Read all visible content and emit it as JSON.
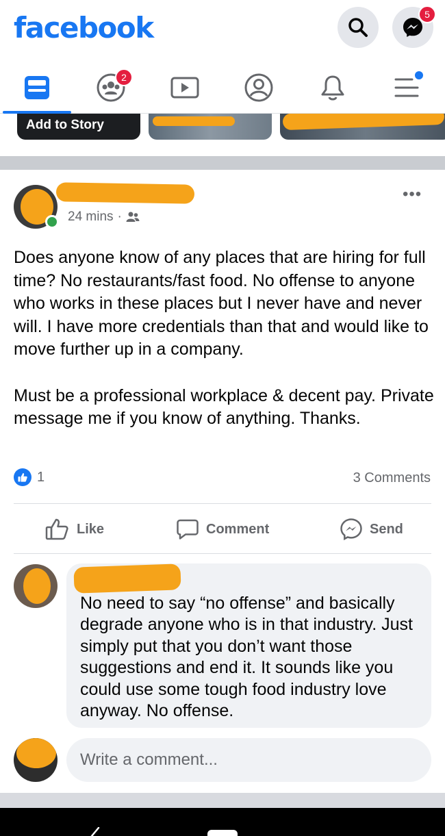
{
  "header": {
    "logo": "facebook",
    "messenger_badge": "5"
  },
  "nav": {
    "groups_badge": "2"
  },
  "stories": {
    "add_label": "Add to Story"
  },
  "post": {
    "timestamp": "24 mins",
    "separator": "·",
    "more": "•••",
    "paragraphs": [
      "Does anyone know of any places that are hiring for full time? No restaurants/fast food. No offense to anyone who works in these places but I never have and never will. I have more credentials than that and would like to move further up in a company.",
      "Must be a professional workplace & decent pay. Private message me if you know of anything. Thanks."
    ],
    "like_count": "1",
    "comments_count": "3 Comments"
  },
  "actions": {
    "like": "Like",
    "comment": "Comment",
    "send": "Send"
  },
  "comment": {
    "text": "No need to say “no offense” and basically degrade anyone who is in that industry. Just simply put that you don’t want those suggestions and end it. It sounds like you could use some tough food industry love anyway. No offense."
  },
  "composer": {
    "placeholder": "Write a comment..."
  },
  "colors": {
    "brand": "#1877f2",
    "badge": "#e41e3f",
    "redaction": "#f5a31a",
    "online": "#31a24c"
  }
}
